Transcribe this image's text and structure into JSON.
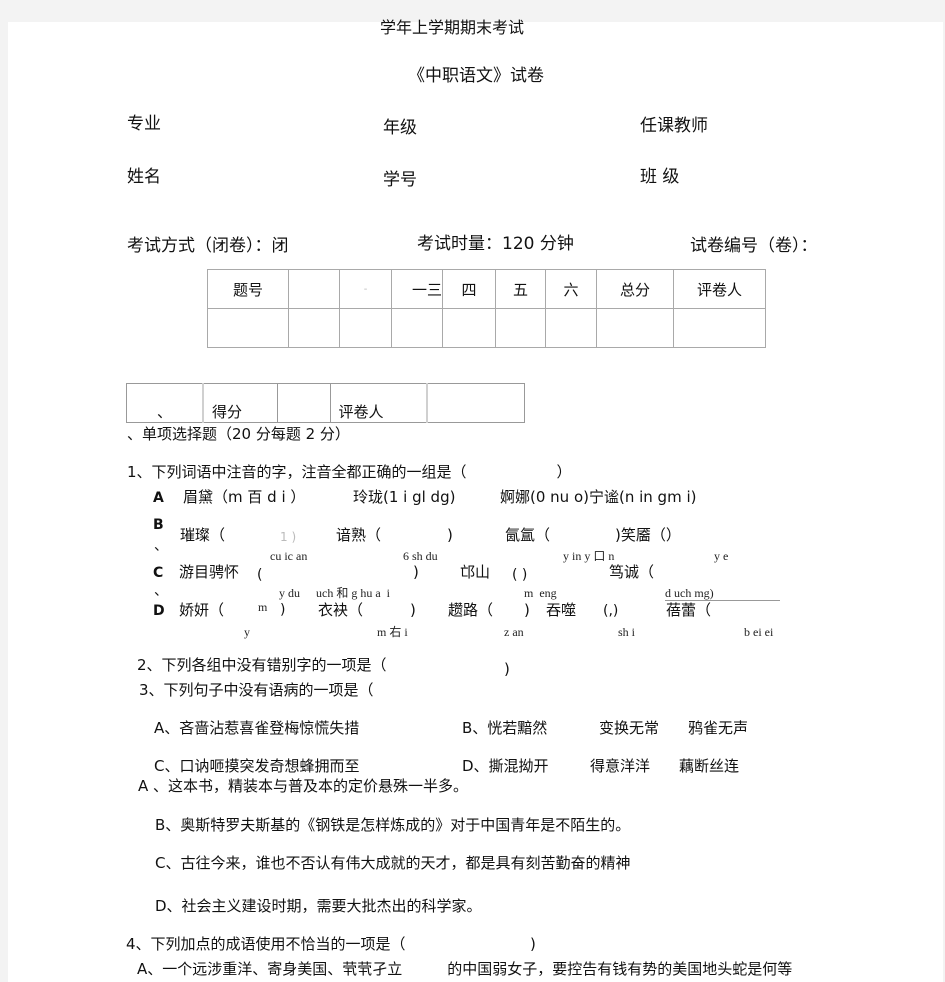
{
  "header": {
    "subtitle": "学年上学期期末考试",
    "title": "《中职语文》试卷"
  },
  "info_fields": {
    "major": "专业",
    "grade": "年级",
    "teacher": "任课教师",
    "name": "姓名",
    "student_no": "学号",
    "class": "班 级"
  },
  "exam_meta": {
    "mode": "考试方式（闭卷）：闭",
    "duration": "考试时量：120 分钟",
    "paper_no": "试卷编号（卷）："
  },
  "score_table": {
    "headers": [
      "题号",
      "",
      "-",
      "一三",
      "四",
      "五",
      "六",
      "总分",
      "评卷人"
    ],
    "scores": [
      "",
      "",
      "",
      "",
      "",
      "",
      "",
      "",
      ""
    ]
  },
  "grader_table": {
    "cells": [
      "、",
      "得分",
      "",
      "评卷人",
      ""
    ]
  },
  "section1": {
    "title": "、单项选择题（20 分每题 2 分）"
  },
  "q1": {
    "stem": "1、下列词语中注音的字，注音全都正确的一组是（　　　　　　）",
    "optA": {
      "label": "A",
      "items": [
        "眉黛（m 百 d i ）",
        "玲珑(1 i gl dg)",
        "婀娜(0 nu o)宁谧(n in gm i)"
      ]
    },
    "optB": {
      "label": "B",
      "sep": "、",
      "items": [
        "璀璨（",
        "1 )",
        "谙熟（",
        ")",
        "氤氲（",
        ")笑靥（）"
      ],
      "pinyin": [
        "cu ic an",
        "6 sh du",
        "y in y 口 n",
        "y e"
      ]
    },
    "optC": {
      "label": "C",
      "sep": "、",
      "items": [
        "游目骋怀",
        "(",
        ")",
        "邙山",
        "( )",
        "笃诚（"
      ],
      "pinyin": [
        "y du",
        "uch 和 g hu a  i",
        "m  eng",
        "d uch mg)"
      ]
    },
    "optD": {
      "label": "D",
      "items": [
        "娇妍（",
        "m",
        ")",
        "衣袂（",
        ")",
        "趱路（",
        ")",
        "吞噬",
        "(,)",
        "蓓蕾（"
      ],
      "pinyin": [
        "y",
        "m 右 i",
        "z an",
        "sh i",
        "b ei ei"
      ]
    }
  },
  "q2": {
    "stem": "2、下列各组中没有错别字的一项是（",
    "close": ")"
  },
  "q3": {
    "stem": "3、下列句子中没有语病的一项是（"
  },
  "q2_options": {
    "A": "A、吝啬沾惹喜雀登梅惊慌失措",
    "B": "B、恍若黯然",
    "B2": "变换无常",
    "B3": "鸦雀无声",
    "C": "C、口讷咂摸突发奇想蜂拥而至",
    "D": "D、撕混拗开",
    "D2": "得意洋洋",
    "D3": "藕断丝连"
  },
  "q3_options": {
    "A": "A 、这本书，精装本与普及本的定价悬殊一半多。",
    "B": "B、奥斯特罗夫斯基的《钢铁是怎样炼成的》对于中国青年是不陌生的。",
    "C": "C、古往今来，谁也不否认有伟大成就的天才，都是具有刻苦勤奋的精神",
    "D": "D、社会主义建设时期，需要大批杰出的科学家。"
  },
  "q4": {
    "stem": "4、下列加点的成语使用不恰当的一项是（",
    "close": ")",
    "optA": "A、一个远涉重洋、寄身美国、茕茕孑立　　　的中国弱女子，要控告有钱有势的美国地头蛇是何等"
  }
}
